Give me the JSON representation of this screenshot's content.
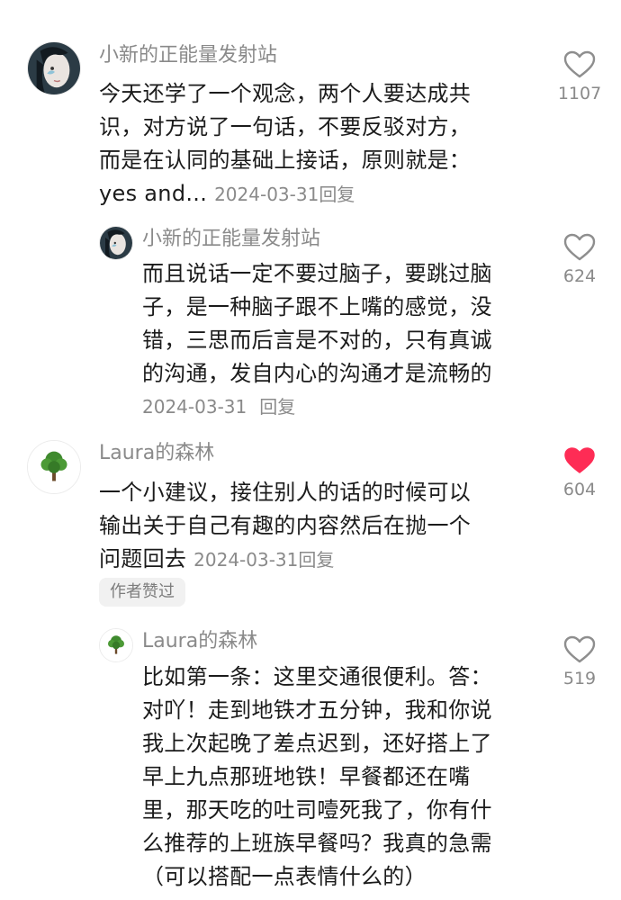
{
  "comments": [
    {
      "username": "小新的正能量发射站",
      "lines": [
        "今天还学了一个观念，两个人要达成共",
        "识，对方说了一句话，不要反驳对方，",
        "而是在认同的基础上接话，原则就是：",
        "yes and..."
      ],
      "date": "2024-03-31",
      "reply_label": "回复",
      "like_count": "1107",
      "liked": false
    },
    {
      "username": "小新的正能量发射站",
      "lines": [
        "而且说话一定不要过脑子，要跳过脑",
        "子，是一种脑子跟不上嘴的感觉，没",
        "错，三思而后言是不对的，只有真诚",
        "的沟通，发自内心的沟通才是流畅的"
      ],
      "date": "2024-03-31",
      "reply_label": "回复",
      "like_count": "624",
      "liked": false
    },
    {
      "username": "Laura的森林",
      "lines": [
        "一个小建议，接住别人的话的时候可以",
        "输出关于自己有趣的内容然后在抛一个",
        "问题回去"
      ],
      "date": "2024-03-31",
      "reply_label": "回复",
      "like_count": "604",
      "liked": true,
      "badge": "作者赞过"
    },
    {
      "username": "Laura的森林",
      "lines": [
        "比如第一条：这里交通很便利。答：",
        "对吖！走到地铁才五分钟，我和你说",
        "我上次起晚了差点迟到，还好搭上了",
        "早上九点那班地铁！早餐都还在嘴",
        "里，那天吃的吐司噎死我了，你有什",
        "么推荐的上班族早餐吗？我真的急需",
        "（可以搭配一点表情什么的）"
      ],
      "like_count": "519",
      "liked": false
    }
  ],
  "colors": {
    "like_active": "#fe2c55",
    "muted": "#8a8a8a",
    "text": "#1b1b1b"
  },
  "icons": {
    "like": "heart-icon",
    "avatar1": "portrait-avatar",
    "avatar2": "tree-avatar"
  }
}
